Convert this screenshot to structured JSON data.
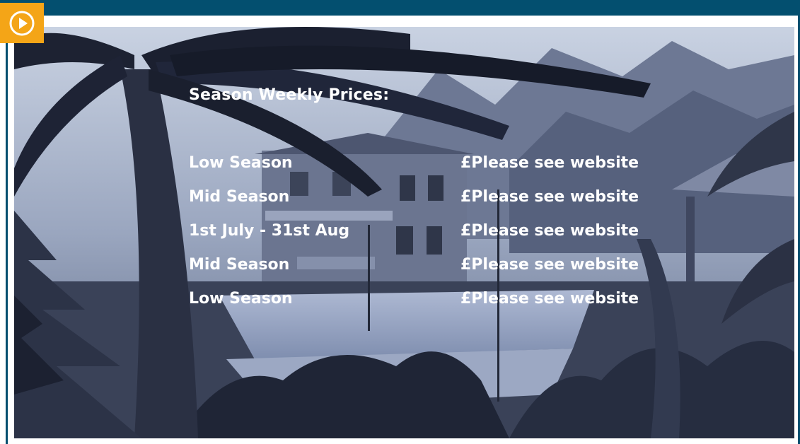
{
  "header": {
    "play_icon": "play-circle-icon",
    "accent_color": "#f4a517",
    "bar_color": "#034f6f"
  },
  "prices": {
    "title": "Season Weekly Prices:",
    "rows": [
      {
        "season": "Low Season",
        "price": "£Please see website"
      },
      {
        "season": "Mid Season",
        "price": "£Please see website"
      },
      {
        "season": "1st July - 31st Aug",
        "price": "£Please see website"
      },
      {
        "season": "Mid Season",
        "price": "£Please see website"
      },
      {
        "season": "Low Season",
        "price": "£Please see website"
      }
    ]
  }
}
